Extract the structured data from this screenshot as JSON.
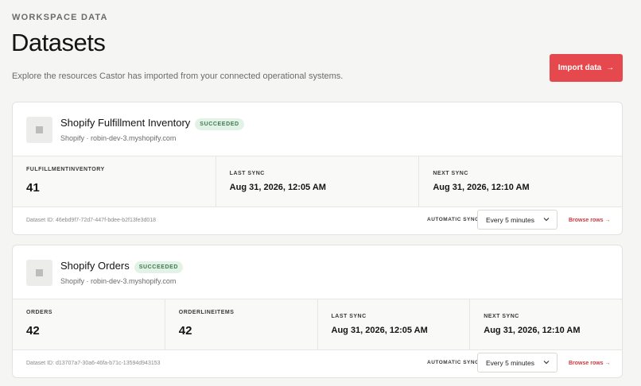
{
  "header": {
    "eyebrow": "WORKSPACE DATA",
    "title": "Datasets",
    "subtitle": "Explore the resources Castor has imported from your connected operational systems.",
    "import_label": "Import data",
    "import_arrow": "→"
  },
  "datasets": [
    {
      "name": "Shopify Fulfillment Inventory",
      "status": "SUCCEEDED",
      "source": "Shopify · robin-dev-3.myshopify.com",
      "counts": [
        {
          "label": "FULFILLMENTINVENTORY",
          "value": "41"
        }
      ],
      "last_sync_label": "LAST SYNC",
      "last_sync": "Aug 31, 2026, 12:05 AM",
      "next_sync_label": "NEXT SYNC",
      "next_sync": "Aug 31, 2026, 12:10 AM",
      "dataset_id": "Dataset ID: 46ebd9f7-72d7-447f-bdee-b2f13fe3d018",
      "auto_sync_label": "AUTOMATIC SYNC",
      "auto_sync_value": "Every 5 minutes",
      "browse_label": "Browse rows →"
    },
    {
      "name": "Shopify Orders",
      "status": "SUCCEEDED",
      "source": "Shopify · robin-dev-3.myshopify.com",
      "counts": [
        {
          "label": "ORDERS",
          "value": "42"
        },
        {
          "label": "ORDERLINEITEMS",
          "value": "42"
        }
      ],
      "last_sync_label": "LAST SYNC",
      "last_sync": "Aug 31, 2026, 12:05 AM",
      "next_sync_label": "NEXT SYNC",
      "next_sync": "Aug 31, 2026, 12:10 AM",
      "dataset_id": "Dataset ID: d13707a7-30a6-46fa-b71c-13594d943153",
      "auto_sync_label": "AUTOMATIC SYNC",
      "auto_sync_value": "Every 5 minutes",
      "browse_label": "Browse rows →"
    }
  ],
  "colors": {
    "accent": "#e5484d",
    "badge_bg": "#e3f2e7",
    "badge_text": "#3a7a4d",
    "link": "#d0383e"
  }
}
